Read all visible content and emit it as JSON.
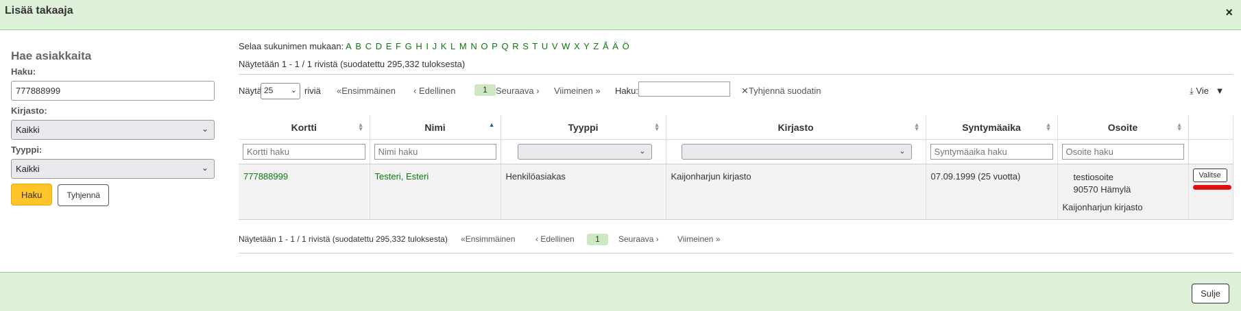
{
  "modal": {
    "title": "Lisää takaaja",
    "close_symbol": "×",
    "footer_close": "Sulje"
  },
  "search_panel": {
    "heading": "Hae asiakkaita",
    "search_label": "Haku:",
    "search_value": "777888999",
    "library_label": "Kirjasto:",
    "library_value": "Kaikki",
    "type_label": "Tyyppi:",
    "type_value": "Kaikki",
    "search_button": "Haku",
    "clear_button": "Tyhjennä"
  },
  "browse": {
    "label": "Selaa sukunimen mukaan:",
    "letters": [
      "A",
      "B",
      "C",
      "D",
      "E",
      "F",
      "G",
      "H",
      "I",
      "J",
      "K",
      "L",
      "M",
      "N",
      "O",
      "P",
      "Q",
      "R",
      "S",
      "T",
      "U",
      "V",
      "W",
      "X",
      "Y",
      "Z",
      "Å",
      "Ä",
      "Ö"
    ]
  },
  "results_info": "Näytetään 1 - 1 / 1 rivistä (suodatettu 295,332 tuloksesta)",
  "toolbar": {
    "show_label": "Näytä",
    "page_size": "25",
    "rows_label": "riviä",
    "first": "Ensimmäinen",
    "previous": "Edellinen",
    "current_page": "1",
    "next": "Seuraava",
    "last": "Viimeinen",
    "filter_label": "Haku:",
    "clear_filter": "Tyhjennä suodatin",
    "export": "Vie"
  },
  "table": {
    "columns": [
      "Kortti",
      "Nimi",
      "Tyyppi",
      "Kirjasto",
      "Syntymäaika",
      "Osoite",
      ""
    ],
    "filter_placeholders": {
      "card": "Kortti haku",
      "name": "Nimi haku",
      "birth": "Syntymäaika haku",
      "address": "Osoite haku"
    },
    "rows": [
      {
        "card": "777888999",
        "name": "Testeri, Esteri",
        "type": "Henkilöasiakas",
        "library": "Kaijonharjun kirjasto",
        "birth": "07.09.1999 (25 vuotta)",
        "address_street": "testiosoite",
        "address_city": "90570 Hämylä",
        "address_library": "Kaijonharjun kirjasto",
        "action": "Valitse"
      }
    ]
  },
  "colors": {
    "header_bg": "#dff0d8",
    "link": "#0a7a0a",
    "primary_button": "#ffc32b",
    "current_page": "#cfe8c4",
    "highlight_mark": "#e01010"
  }
}
